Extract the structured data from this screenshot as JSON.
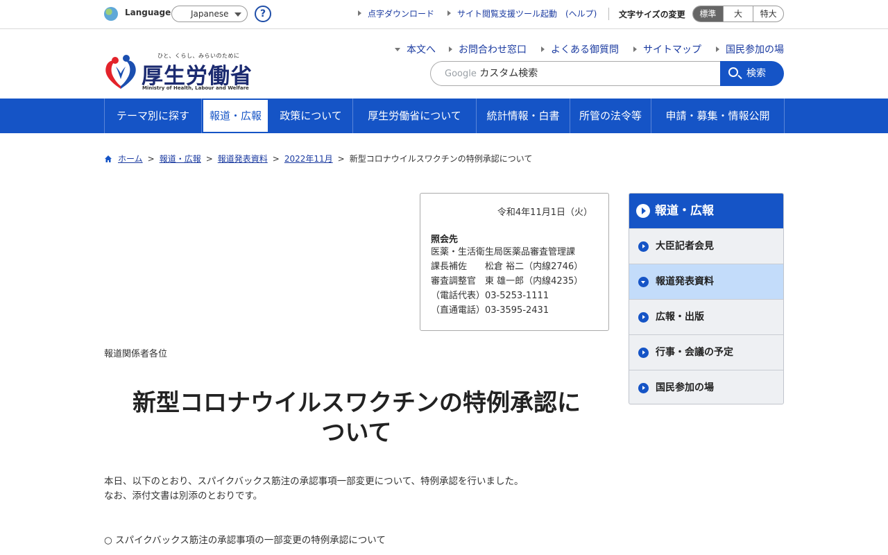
{
  "utility": {
    "language_label": "Language",
    "language_value": "Japanese",
    "help_label": "?",
    "links": [
      {
        "label": "点字ダウンロード"
      },
      {
        "label": "サイト閲覧支援ツール起動　(ヘルプ)"
      }
    ],
    "font_size_label": "文字サイズの変更",
    "font_sizes": [
      {
        "label": "標準",
        "active": true
      },
      {
        "label": "大",
        "active": false
      },
      {
        "label": "特大",
        "active": false
      }
    ]
  },
  "header": {
    "logo_tagline": "ひと、くらし、みらいのために",
    "logo_name": "厚生労働省",
    "logo_english": "Ministry of Health, Labour and Welfare",
    "links": [
      {
        "label": "本文へ"
      },
      {
        "label": "お問合わせ窓口"
      },
      {
        "label": "よくある御質問"
      },
      {
        "label": "サイトマップ"
      },
      {
        "label": "国民参加の場"
      }
    ],
    "search_brand": "Google",
    "search_placeholder": "カスタム検索",
    "search_button": "検索"
  },
  "nav": [
    {
      "label": "テーマ別に探す"
    },
    {
      "label": "報道・広報"
    },
    {
      "label": "政策について"
    },
    {
      "label": "厚生労働省について"
    },
    {
      "label": "統計情報・白書"
    },
    {
      "label": "所管の法令等"
    },
    {
      "label": "申請・募集・情報公開"
    }
  ],
  "breadcrumb": [
    {
      "label": "ホーム"
    },
    {
      "label": "報道・広報"
    },
    {
      "label": "報道発表資料"
    },
    {
      "label": "2022年11月"
    },
    {
      "label": "新型コロナウイルスワクチンの特例承認について"
    }
  ],
  "contact": {
    "date": "令和4年11月1日（火）",
    "heading": "照会先",
    "lines": [
      "医薬・生活衛生局医薬品審査管理課",
      "課長補佐　　松倉 裕二（内線2746）",
      "審査調整官　東 雄一郎（内線4235）",
      "（電話代表）03-5253-1111",
      "（直通電話）03-3595-2431"
    ]
  },
  "main": {
    "addressee": "報道関係者各位",
    "title_line1": "新型コロナウイルスワクチンの特例承認に",
    "title_line2": "ついて",
    "body_line1": "本日、以下のとおり、スパイクバックス筋注の承認事項一部変更について、特例承認を行いました。",
    "body_line2": "なお、添付文書は別添のとおりです。",
    "list_item": "○ スパイクバックス筋注の承認事項の一部変更の特例承認について"
  },
  "sidebar": {
    "title": "報道・広報",
    "items": [
      {
        "label": "大臣記者会見",
        "active": false
      },
      {
        "label": "報道発表資料",
        "active": true
      },
      {
        "label": "広報・出版",
        "active": false
      },
      {
        "label": "行事・会議の予定",
        "active": false
      },
      {
        "label": "国民参加の場",
        "active": false
      }
    ]
  },
  "colors": {
    "primary_blue": "#1554c6",
    "link_blue": "#1a3aa0",
    "sidebar_active": "#c3dcfa"
  }
}
